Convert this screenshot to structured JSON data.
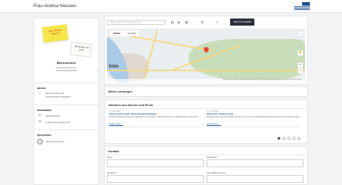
{
  "header": {
    "title": "Frau Andrea Niessen",
    "logo": "steuerberaterkammer-logo"
  },
  "profile": {
    "note_yellow": "Jetzt Steuern sparen!",
    "note_white": "Wir beraten Sie gern!",
    "office_name": "Büroservice",
    "sub1": "Frau Andrea Niessen",
    "sub2": "Steuerfachangestellte",
    "address_label": "Adresse",
    "street": "Beethovenallee 90",
    "city": "51427 Bergisch Gladbach",
    "contact_label": "Kontaktdaten",
    "phone": "02204 951616",
    "email": "andrea.niessen@gmx.de",
    "hours_label": "Sprechzeiten",
    "hours": "nach Vereinbarung"
  },
  "map": {
    "search_placeholder": "Bitte tragen Sie Ihre Adresse ein",
    "route_button": "ROUTE PLANEN",
    "tab_map": "Karte",
    "tab_satellite": "Satellit",
    "city_label": "Köln",
    "attribution": "Kurzbefehle  Kartendaten ©2024 GeoBasis-DE/BKG (©2009), Google  Nutzungsbedingungen  Fehler bei Google Maps melden"
  },
  "services": {
    "title": "Meine Leistungen"
  },
  "news": {
    "title": "Aktuelles aus Steuern und Recht",
    "items": [
      {
        "date": "27. Juli 2024",
        "headline": "Steuerreduzierungen durch Betriebsprüfungen",
        "text": "Mit Hilfe der Betriebsprüfungen haben Bund und Länder im Jahr 2023 Steuern in Milliardenhöhe eingetrieben.",
        "link": "Artikel lesen →"
      },
      {
        "date": "27. Juli 2024",
        "headline": "Minderlohn deutlich höher",
        "text": "Bundesminister Olaf Scholz (SPD) hat sich erneut für eine kräftige Erhöhung des gesetzlichen Mindestlohns ausgesprochen.",
        "link": "Artikel lesen →"
      }
    ],
    "pages": [
      "1",
      "2",
      "3",
      "4",
      "5"
    ]
  },
  "contact": {
    "title": "Kontakt",
    "firma": "Firma",
    "email": "Ihre Email *",
    "name": "Ihr Name *",
    "phone": "Ihre Telefonnummer"
  }
}
